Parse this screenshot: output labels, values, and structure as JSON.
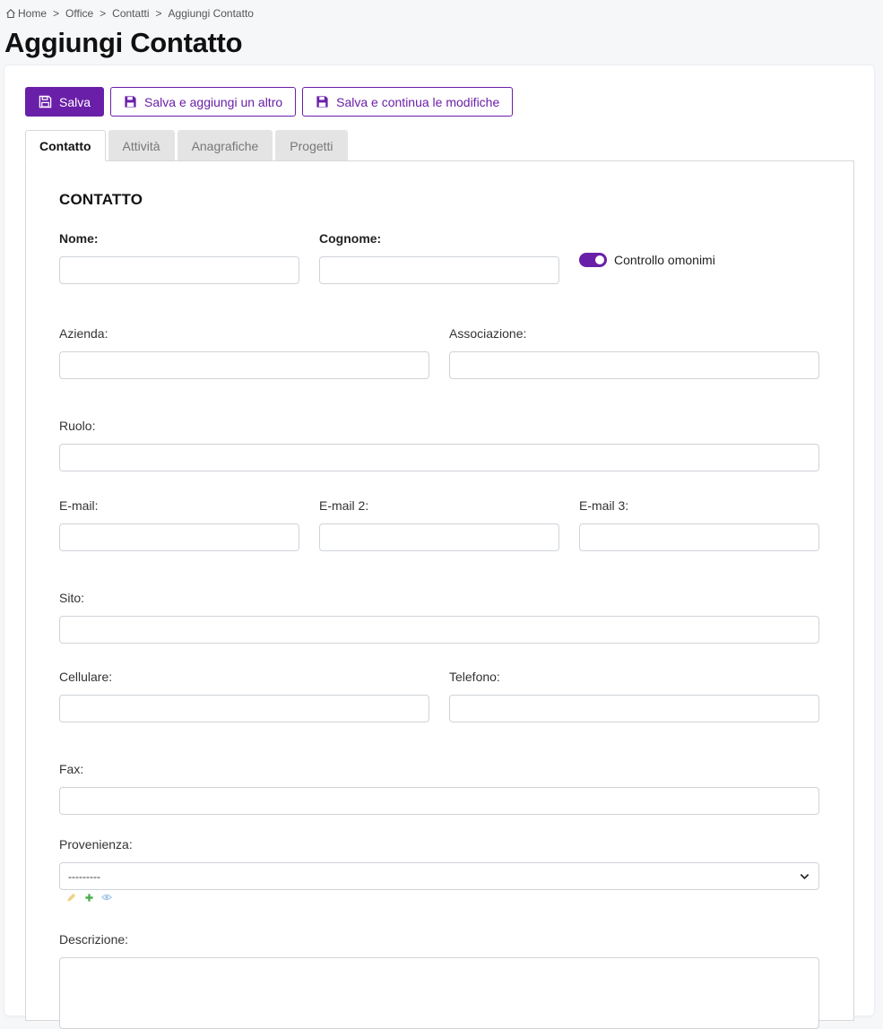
{
  "breadcrumb": {
    "items": [
      "Home",
      "Office",
      "Contatti",
      "Aggiungi Contatto"
    ],
    "separator": ">"
  },
  "page": {
    "title": "Aggiungi Contatto"
  },
  "toolbar": {
    "save_label": "Salva",
    "save_add_label": "Salva e aggiungi un altro",
    "save_continue_label": "Salva e continua le modifiche"
  },
  "tabs": [
    {
      "label": "Contatto",
      "active": true
    },
    {
      "label": "Attività",
      "active": false
    },
    {
      "label": "Anagrafiche",
      "active": false
    },
    {
      "label": "Progetti",
      "active": false
    }
  ],
  "form": {
    "section_title": "CONTATTO",
    "fields": {
      "nome": {
        "label": "Nome:",
        "value": ""
      },
      "cognome": {
        "label": "Cognome:",
        "value": ""
      },
      "azienda": {
        "label": "Azienda:",
        "value": ""
      },
      "associazione": {
        "label": "Associazione:",
        "value": ""
      },
      "ruolo": {
        "label": "Ruolo:",
        "value": ""
      },
      "email": {
        "label": "E-mail:",
        "value": ""
      },
      "email2": {
        "label": "E-mail 2:",
        "value": ""
      },
      "email3": {
        "label": "E-mail 3:",
        "value": ""
      },
      "sito": {
        "label": "Sito:",
        "value": ""
      },
      "cellulare": {
        "label": "Cellulare:",
        "value": ""
      },
      "telefono": {
        "label": "Telefono:",
        "value": ""
      },
      "fax": {
        "label": "Fax:",
        "value": ""
      },
      "provenienza": {
        "label": "Provenienza:",
        "selected": "---------"
      },
      "descrizione": {
        "label": "Descrizione:",
        "value": ""
      }
    },
    "homonym_toggle": {
      "label": "Controllo omonimi",
      "checked": true
    }
  },
  "icons": {
    "home": "home-icon",
    "save": "floppy-disk-icon",
    "dropdown": "chevron-down-icon",
    "edit": "pencil-icon",
    "add": "plus-icon",
    "view": "eye-icon"
  },
  "colors": {
    "accent": "#6a1fa8",
    "edit_icon": "#f0d68a",
    "add_icon": "#4caf50",
    "view_icon": "#9ec5e8"
  }
}
